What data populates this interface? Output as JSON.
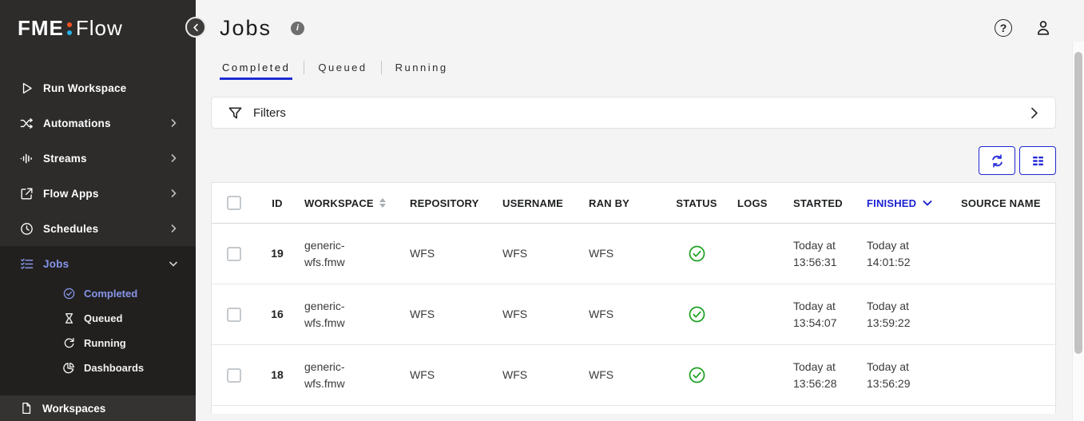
{
  "colors": {
    "accent_blue": "#1d23d0",
    "periwinkle": "#8794e8",
    "success_green": "#1ea223",
    "logo_dot_top": "#ff531f",
    "logo_dot_bottom": "#27b3e8",
    "sidebar_bg": "#2d2c2b",
    "sidebar_expanded_bg": "#21201f",
    "workspaces_bg": "#343332",
    "page_bg": "#f4f4f4"
  },
  "sidebar": {
    "logo": {
      "fme": "FME",
      "flow": "Flow"
    },
    "items": [
      {
        "label": "Run Workspace"
      },
      {
        "label": "Automations"
      },
      {
        "label": "Streams"
      },
      {
        "label": "Flow Apps"
      },
      {
        "label": "Schedules"
      }
    ],
    "jobs": {
      "label": "Jobs",
      "children": [
        {
          "label": "Completed"
        },
        {
          "label": "Queued"
        },
        {
          "label": "Running"
        },
        {
          "label": "Dashboards"
        }
      ],
      "active_child": "Completed"
    },
    "workspaces_label": "Workspaces"
  },
  "header": {
    "title": "Jobs"
  },
  "tabs": {
    "items": [
      {
        "label": "Completed"
      },
      {
        "label": "Queued"
      },
      {
        "label": "Running"
      }
    ],
    "active": "Completed"
  },
  "filters": {
    "label": "Filters"
  },
  "table": {
    "headers": {
      "id": "ID",
      "workspace": "WORKSPACE",
      "repository": "REPOSITORY",
      "username": "USERNAME",
      "ran_by": "RAN BY",
      "status": "STATUS",
      "logs": "LOGS",
      "started": "STARTED",
      "finished": "FINISHED",
      "source_name": "SOURCE NAME"
    },
    "sort_column": "FINISHED",
    "sort_direction": "desc",
    "rows": [
      {
        "id": "19",
        "workspace": "generic-wfs.fmw",
        "repository": "WFS",
        "username": "WFS",
        "ran_by": "WFS",
        "status": "success",
        "logs": "",
        "started": "Today at 13:56:31",
        "finished": "Today at 14:01:52",
        "source_name": ""
      },
      {
        "id": "16",
        "workspace": "generic-wfs.fmw",
        "repository": "WFS",
        "username": "WFS",
        "ran_by": "WFS",
        "status": "success",
        "logs": "",
        "started": "Today at 13:54:07",
        "finished": "Today at 13:59:22",
        "source_name": ""
      },
      {
        "id": "18",
        "workspace": "generic-wfs.fmw",
        "repository": "WFS",
        "username": "WFS",
        "ran_by": "WFS",
        "status": "success",
        "logs": "",
        "started": "Today at 13:56:28",
        "finished": "Today at 13:56:29",
        "source_name": ""
      }
    ]
  }
}
